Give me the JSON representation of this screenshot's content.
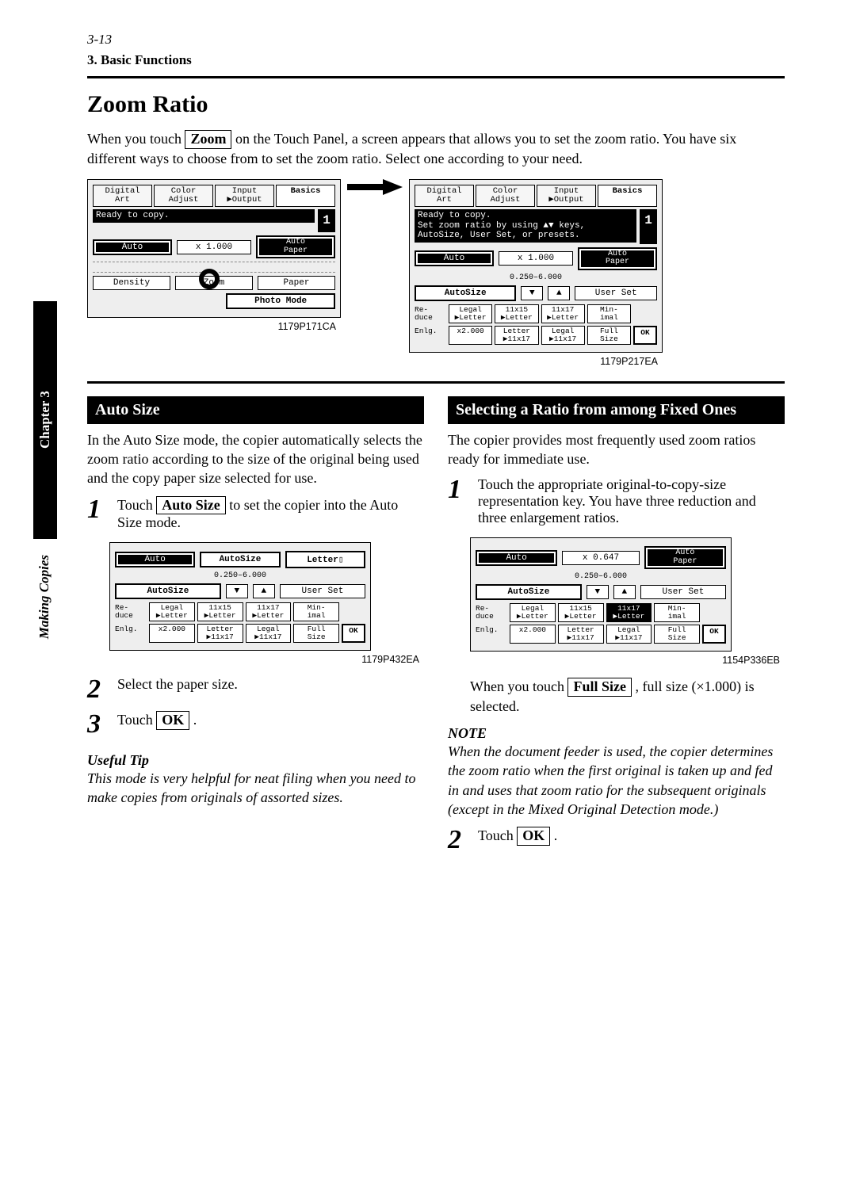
{
  "page_header": {
    "page_num": "3-13",
    "crumb": "3. Basic Functions"
  },
  "sidebar": {
    "chapter": "Chapter 3",
    "section": "Making Copies"
  },
  "title": "Zoom Ratio",
  "intro": {
    "pre": "When you touch ",
    "button": "Zoom",
    "post": " on the Touch Panel, a screen appears that allows you to set the zoom ratio. You have six different ways to choose from to set the zoom ratio. Select one according to your need."
  },
  "captions": {
    "panel_left": "1179P171CA",
    "panel_right": "1179P217EA",
    "autosize_panel": "1179P432EA",
    "fixed_panel": "1154P336EB"
  },
  "panels": {
    "tabs": {
      "t1": "Digital\nArt",
      "t2": "Color\nAdjust",
      "t3": "Input\n▶Output",
      "t4": "Basics"
    },
    "status_ready": "Ready to copy.",
    "status_zoom": "Ready to copy.\nSet zoom ratio by using ▲▼ keys,\nAutoSize, User Set, or presets.",
    "auto": "Auto",
    "zoom_val": "x 1.000",
    "zoom_val2": "x 0.647",
    "auto_paper": "Auto\nPaper",
    "density": "Density",
    "zoom": "Zoom",
    "paper": "Paper",
    "photo": "Photo Mode",
    "autosize_btn": "AutoSize",
    "autosize_lbl": "AutoSize",
    "range": "0.250–6.000",
    "userset": "User Set",
    "reduce": "Re-\nduce",
    "enlarge": "Enlg.",
    "chips_reduce": [
      "Legal\n▶Letter",
      "11x15\n▶Letter",
      "11x17\n▶Letter",
      "Min-\nimal"
    ],
    "chips_enlarge": [
      "x2.000",
      "Letter\n▶11x17",
      "Legal\n▶11x17",
      "Full\nSize"
    ],
    "ok": "OK",
    "letter_tab": "Letter▯",
    "down": "▼",
    "up": "▲",
    "count": "1"
  },
  "left": {
    "h": "Auto Size",
    "p": "In the Auto Size mode, the copier automatically selects the zoom ratio according to the size of the original being used and the copy paper size selected for use.",
    "step1_pre": "Touch ",
    "step1_btn": "Auto Size",
    "step1_post": " to set the copier into the Auto Size mode.",
    "step2": "Select the paper size.",
    "step3_pre": "Touch ",
    "step3_btn": "OK",
    "step3_post": " .",
    "tip_h": "Useful Tip",
    "tip_b": "This mode is very helpful for neat filing when you need to make copies from originals of assorted sizes."
  },
  "right": {
    "h": "Selecting a Ratio from among Fixed Ones",
    "p": "The copier provides most frequently used zoom ratios ready for immediate use.",
    "step1": "Touch the appropriate original-to-copy-size representation key. You have three reduction and three enlargement ratios.",
    "after_pre": "When you touch ",
    "after_btn": "Full Size",
    "after_post": " , full size (×1.000) is selected.",
    "note_h": "NOTE",
    "note_b": "When the document feeder is used, the copier determines the zoom ratio when the first original is taken up and fed in and uses that zoom ratio for the subsequent originals (except in the Mixed Original Detection mode.)",
    "step2_pre": "Touch ",
    "step2_btn": "OK",
    "step2_post": " ."
  },
  "steps": {
    "n1": "1",
    "n2": "2",
    "n3": "3"
  }
}
